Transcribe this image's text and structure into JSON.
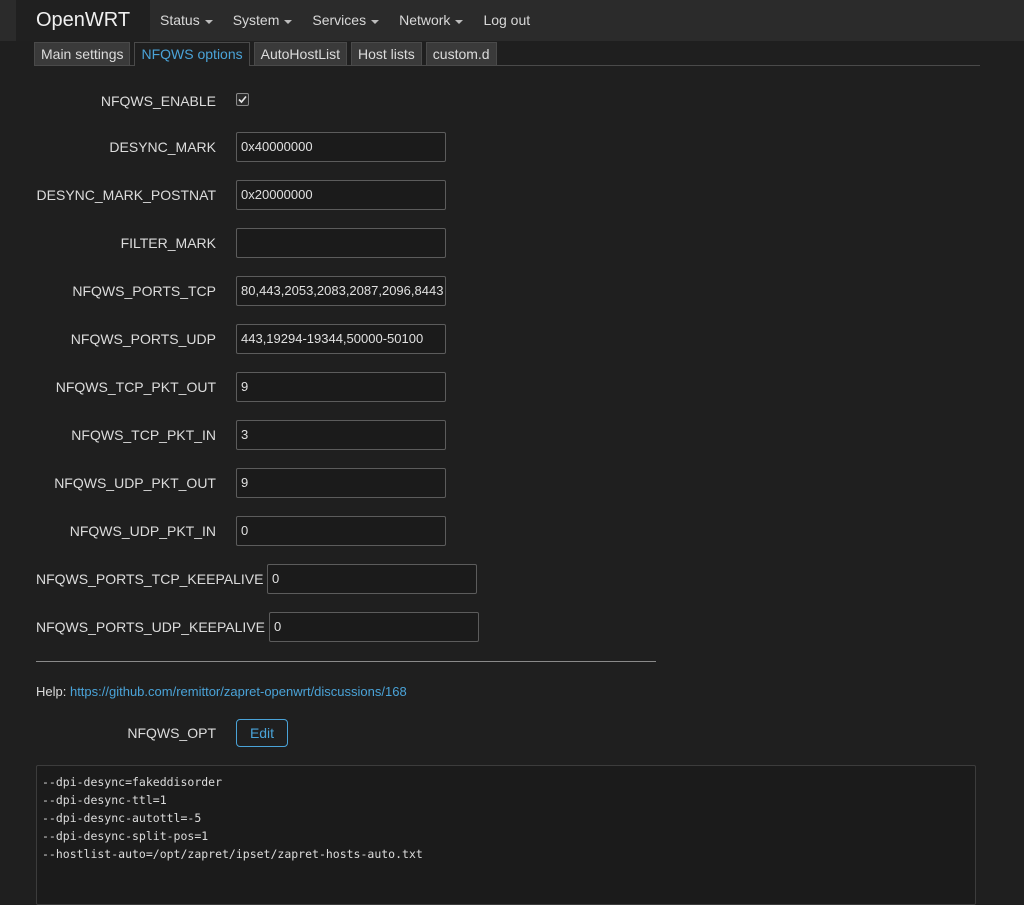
{
  "navbar": {
    "brand": "OpenWRT",
    "menu": [
      {
        "label": "Status",
        "dropdown": true
      },
      {
        "label": "System",
        "dropdown": true
      },
      {
        "label": "Services",
        "dropdown": true
      },
      {
        "label": "Network",
        "dropdown": true
      },
      {
        "label": "Log out",
        "dropdown": false
      }
    ]
  },
  "tabs": [
    {
      "label": "Main settings",
      "active": false
    },
    {
      "label": "NFQWS options",
      "active": true
    },
    {
      "label": "AutoHostList",
      "active": false
    },
    {
      "label": "Host lists",
      "active": false
    },
    {
      "label": "custom.d",
      "active": false
    }
  ],
  "form": {
    "nfqws_enable": {
      "label": "NFQWS_ENABLE",
      "checked": true
    },
    "desync_mark": {
      "label": "DESYNC_MARK",
      "value": "0x40000000"
    },
    "desync_mark_postnat": {
      "label": "DESYNC_MARK_POSTNAT",
      "value": "0x20000000"
    },
    "filter_mark": {
      "label": "FILTER_MARK",
      "value": ""
    },
    "nfqws_ports_tcp": {
      "label": "NFQWS_PORTS_TCP",
      "value": "80,443,2053,2083,2087,2096,8443"
    },
    "nfqws_ports_udp": {
      "label": "NFQWS_PORTS_UDP",
      "value": "443,19294-19344,50000-50100"
    },
    "nfqws_tcp_pkt_out": {
      "label": "NFQWS_TCP_PKT_OUT",
      "value": "9"
    },
    "nfqws_tcp_pkt_in": {
      "label": "NFQWS_TCP_PKT_IN",
      "value": "3"
    },
    "nfqws_udp_pkt_out": {
      "label": "NFQWS_UDP_PKT_OUT",
      "value": "9"
    },
    "nfqws_udp_pkt_in": {
      "label": "NFQWS_UDP_PKT_IN",
      "value": "0"
    },
    "nfqws_ports_tcp_keepalive": {
      "label": "NFQWS_PORTS_TCP_KEEPALIVE",
      "value": "0"
    },
    "nfqws_ports_udp_keepalive": {
      "label": "NFQWS_PORTS_UDP_KEEPALIVE",
      "value": "0"
    }
  },
  "help": {
    "prefix": "Help: ",
    "link": "https://github.com/remittor/zapret-openwrt/discussions/168"
  },
  "nfqws_opt": {
    "label": "NFQWS_OPT",
    "edit_label": "Edit",
    "lines": [
      "--dpi-desync=fakeddisorder",
      "--dpi-desync-ttl=1",
      "--dpi-desync-autottl=-5",
      "--dpi-desync-split-pos=1",
      "--hostlist-auto=/opt/zapret/ipset/zapret-hosts-auto.txt"
    ]
  },
  "colors": {
    "accent": "#4aa3d8",
    "background": "#1f1f1f",
    "navbar": "#2b2b2b"
  }
}
